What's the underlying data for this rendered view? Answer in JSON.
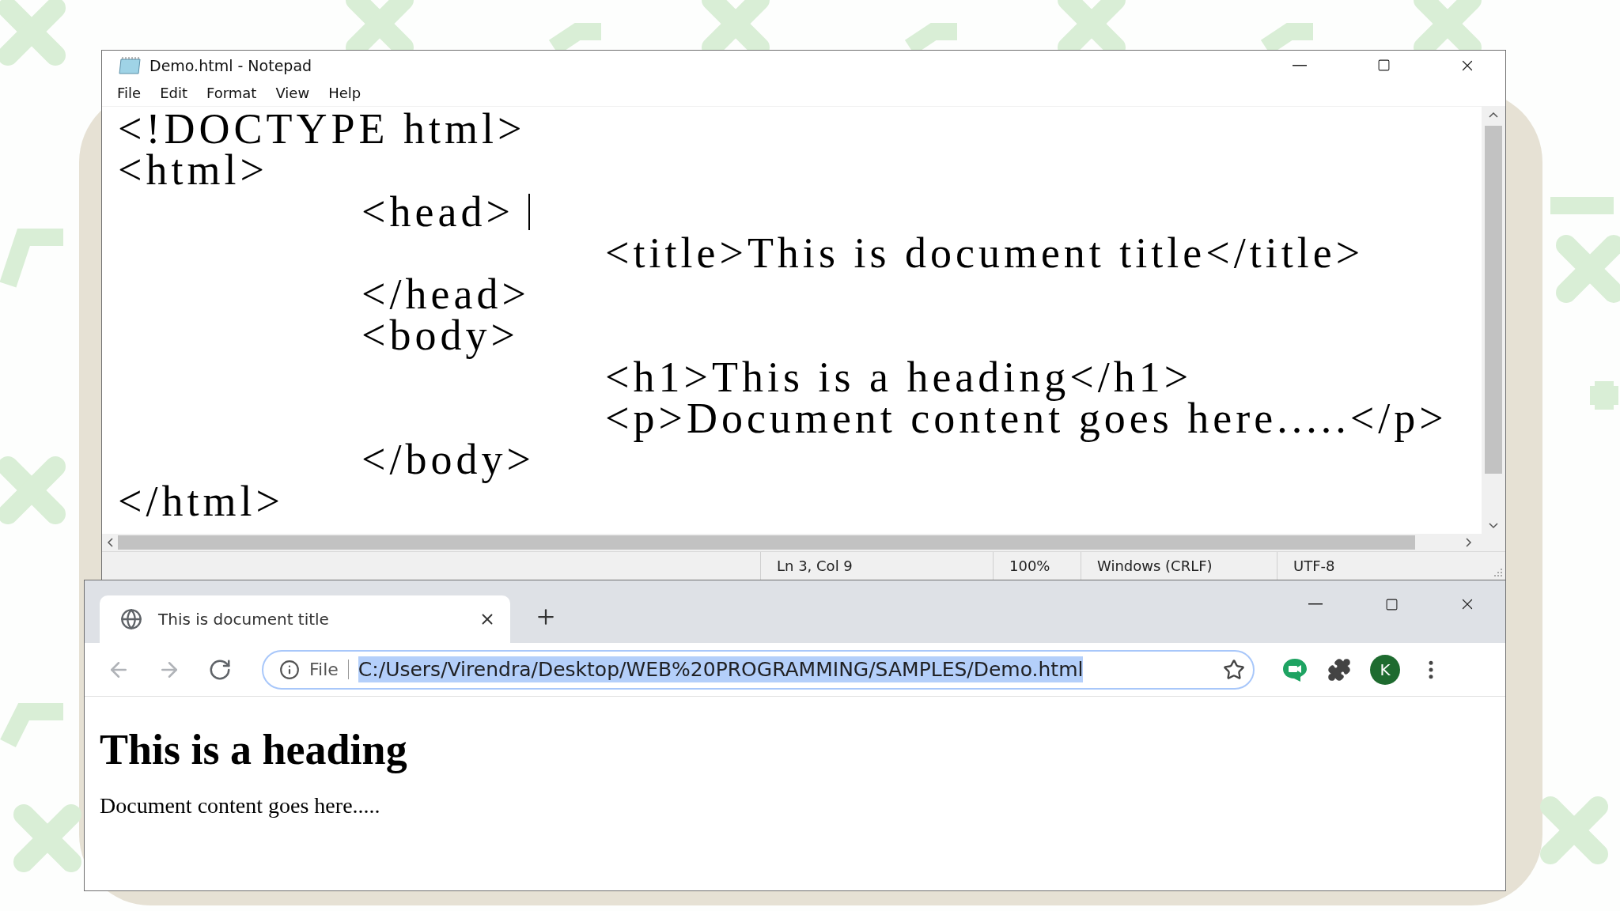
{
  "notepad": {
    "title": "Demo.html - Notepad",
    "menu": [
      "File",
      "Edit",
      "Format",
      "View",
      "Help"
    ],
    "lines": [
      {
        "text": "<!DOCTYPE html>",
        "caret": false
      },
      {
        "text": "<html>",
        "caret": false
      },
      {
        "text": "\t<head> ",
        "caret": true
      },
      {
        "text": "\t\t<title>This is document title</title>",
        "caret": false
      },
      {
        "text": "\t</head>",
        "caret": false
      },
      {
        "text": "\t<body>",
        "caret": false
      },
      {
        "text": "\t\t<h1>This is a heading</h1>",
        "caret": false
      },
      {
        "text": "\t\t<p>Document content goes here.....</p>",
        "caret": false
      },
      {
        "text": "\t</body>",
        "caret": false
      },
      {
        "text": "</html>",
        "caret": false
      }
    ],
    "status": [
      "Ln 3, Col 9",
      "100%",
      "Windows (CRLF)",
      "UTF-8"
    ]
  },
  "browser": {
    "tab_title": "This is document title",
    "nav": [
      {
        "kind": "back",
        "disabled": true
      },
      {
        "kind": "forward",
        "disabled": true
      },
      {
        "kind": "reload",
        "disabled": false
      }
    ],
    "address": {
      "scheme": "File",
      "url": "C:/Users/Virendra/Desktop/WEB%20PROGRAMMING/SAMPLES/Demo.html",
      "selected": true
    },
    "profile": "K",
    "page": {
      "heading": "This is a heading",
      "paragraph": "Document content goes here....."
    }
  }
}
